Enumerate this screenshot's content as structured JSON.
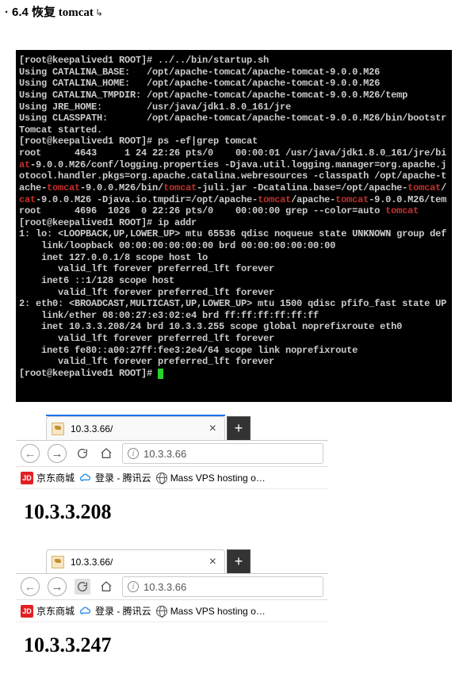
{
  "heading": {
    "number": "6.4",
    "text": "恢复 tomcat"
  },
  "terminal": {
    "l1_prompt": "[root@keepalived1 ROOT]# ",
    "l1_cmd": "../../bin/startup.sh",
    "l2": "Using CATALINA_BASE:   /opt/apache-tomcat/apache-tomcat-9.0.0.M26",
    "l3": "Using CATALINA_HOME:   /opt/apache-tomcat/apache-tomcat-9.0.0.M26",
    "l4": "Using CATALINA_TMPDIR: /opt/apache-tomcat/apache-tomcat-9.0.0.M26/temp",
    "l5": "Using JRE_HOME:        /usr/java/jdk1.8.0_161/jre",
    "l6": "Using CLASSPATH:       /opt/apache-tomcat/apache-tomcat-9.0.0.M26/bin/bootstr",
    "l7": "Tomcat started.",
    "l8_prompt": "[root@keepalived1 ROOT]# ",
    "l8_cmd": "ps -ef|grep tomcat",
    "l9": "root      4643     1 24 22:26 pts/0    00:00:01 /usr/java/jdk1.8.0_161/jre/bi",
    "l10_a": "at",
    "l10_b": "-9.0.0.M26/conf/logging.properties -Djava.util.logging.manager=org.apache.j",
    "l11": "otocol.handler.pkgs=org.apache.catalina.webresources -classpath /opt/apache-t",
    "l12_a": "ache-",
    "l12_b": "tomcat",
    "l12_c": "-9.0.0.M26/bin/",
    "l12_d": "tomcat",
    "l12_e": "-juli.jar -Dcatalina.base=/opt/apache-",
    "l12_f": "tomcat",
    "l12_g": "/",
    "l13_a": "cat",
    "l13_b": "-9.0.0.M26 -Djava.io.tmpdir=/opt/apache-",
    "l13_c": "tomcat",
    "l13_d": "/apache-",
    "l13_e": "tomcat",
    "l13_f": "-9.0.0.M26/tem",
    "l14_a": "root      4696  1026  0 22:26 pts/0    00:00:00 grep --color=auto ",
    "l14_b": "tomcat",
    "l15_prompt": "[root@keepalived1 ROOT]# ",
    "l15_cmd": "ip addr",
    "l16": "1: lo: <LOOPBACK,UP,LOWER_UP> mtu 65536 qdisc noqueue state UNKNOWN group def",
    "l17": "    link/loopback 00:00:00:00:00:00 brd 00:00:00:00:00:00",
    "l18": "    inet 127.0.0.1/8 scope host lo",
    "l19": "       valid_lft forever preferred_lft forever",
    "l20": "    inet6 ::1/128 scope host",
    "l21": "       valid_lft forever preferred_lft forever",
    "l22": "2: eth0: <BROADCAST,MULTICAST,UP,LOWER_UP> mtu 1500 qdisc pfifo_fast state UP",
    "l23": "    link/ether 08:00:27:e3:02:e4 brd ff:ff:ff:ff:ff:ff",
    "l24": "    inet 10.3.3.208/24 brd 10.3.3.255 scope global noprefixroute eth0",
    "l25": "       valid_lft forever preferred_lft forever",
    "l26": "    inet6 fe80::a00:27ff:fee3:2e4/64 scope link noprefixroute",
    "l27": "       valid_lft forever preferred_lft forever",
    "l28_prompt": "[root@keepalived1 ROOT]# "
  },
  "browser1": {
    "tab_title": "10.3.3.66/",
    "new_tab": "+",
    "close": "×",
    "back": "←",
    "forward": "→",
    "address": "10.3.3.66",
    "info": "i",
    "bm_jd": "JD",
    "bm_jd_text": "京东商城",
    "bm_tencent": "登录 - 腾讯云",
    "bm_vps": "Mass VPS hosting o…",
    "page_text": "10.3.3.208"
  },
  "browser2": {
    "tab_title": "10.3.3.66/",
    "new_tab": "+",
    "close": "×",
    "back": "←",
    "forward": "→",
    "address": "10.3.3.66",
    "info": "i",
    "bm_jd": "JD",
    "bm_jd_text": "京东商城",
    "bm_tencent": "登录 - 腾讯云",
    "bm_vps": "Mass VPS hosting o…",
    "page_text": "10.3.3.247"
  }
}
